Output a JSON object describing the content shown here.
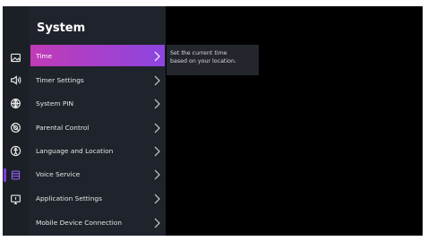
{
  "panel": {
    "title": "System"
  },
  "rail": {
    "icons": [
      "picture-icon",
      "sound-icon",
      "network-icon",
      "general-icon",
      "accessibility-icon",
      "system-icon",
      "support-icon"
    ],
    "selected": "system-icon",
    "accent": "#7b3fe4"
  },
  "menu": {
    "items": [
      {
        "label": "Time",
        "selected": true
      },
      {
        "label": "Timer Settings"
      },
      {
        "label": "System PIN"
      },
      {
        "label": "Parental Control"
      },
      {
        "label": "Language and Location"
      },
      {
        "label": "Voice Service"
      },
      {
        "label": "Application Settings"
      },
      {
        "label": "Mobile Device Connection"
      }
    ],
    "selected_gradient": [
      "#c03bb6",
      "#8c45e0"
    ]
  },
  "tooltip": {
    "line1": "Set the current time",
    "line2": "based on your location."
  }
}
